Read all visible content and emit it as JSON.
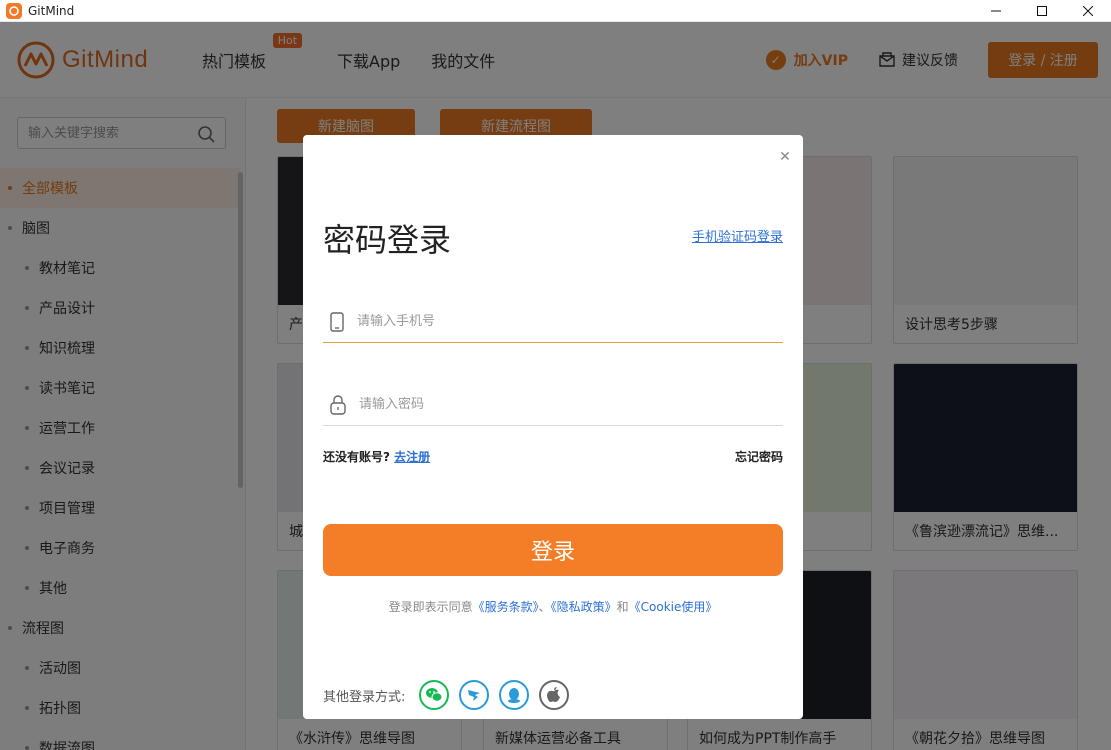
{
  "window": {
    "title": "GitMind"
  },
  "header": {
    "brand": "GitMind",
    "nav": [
      {
        "label": "热门模板",
        "badge": "Hot"
      },
      {
        "label": "下载App"
      },
      {
        "label": "我的文件"
      }
    ],
    "vip_label": "加入VIP",
    "feedback_label": "建议反馈",
    "login_label": "登录 / 注册"
  },
  "sidebar": {
    "search_placeholder": "输入关键字搜索",
    "items": [
      {
        "label": "全部模板",
        "level": "top",
        "active": true
      },
      {
        "label": "脑图",
        "level": "top"
      },
      {
        "label": "教材笔记",
        "level": "sub"
      },
      {
        "label": "产品设计",
        "level": "sub"
      },
      {
        "label": "知识梳理",
        "level": "sub"
      },
      {
        "label": "读书笔记",
        "level": "sub"
      },
      {
        "label": "运营工作",
        "level": "sub"
      },
      {
        "label": "会议记录",
        "level": "sub"
      },
      {
        "label": "项目管理",
        "level": "sub"
      },
      {
        "label": "电子商务",
        "level": "sub"
      },
      {
        "label": "其他",
        "level": "sub"
      },
      {
        "label": "流程图",
        "level": "top"
      },
      {
        "label": "活动图",
        "level": "sub"
      },
      {
        "label": "拓扑图",
        "level": "sub"
      },
      {
        "label": "数据流图",
        "level": "sub"
      }
    ]
  },
  "main": {
    "new_mindmap": "新建脑图",
    "new_flowchart": "新建流程图",
    "cards": [
      {
        "label": "产",
        "thumb": "#2a2a2e"
      },
      {
        "label": "",
        "thumb": "#f6e9e9"
      },
      {
        "label": "设计思考5步骤",
        "thumb": "#f3f3f3"
      },
      {
        "label": "城",
        "thumb": "#e6e6ec"
      },
      {
        "label": "",
        "thumb": "#e7f0d8"
      },
      {
        "label": "《鲁滨逊漂流记》思维...",
        "thumb": "#1d2032"
      },
      {
        "label": "《水浒传》思维导图",
        "thumb": "#e3f1ea"
      },
      {
        "label": "新媒体运营必备工具",
        "thumb": "#ffffff"
      },
      {
        "label": "如何成为PPT制作高手",
        "thumb": "#1f2126"
      },
      {
        "label": "《朝花夕拾》思维导图",
        "thumb": "#f6f0f6"
      }
    ]
  },
  "modal": {
    "title": "密码登录",
    "sms_link": "手机验证码登录",
    "phone_placeholder": "请输入手机号",
    "password_placeholder": "请输入密码",
    "no_account": "还没有账号?",
    "register_link": "去注册",
    "forgot": "忘记密码",
    "submit": "登录",
    "agreement_prefix": "登录即表示同意",
    "terms": "《服务条款》",
    "sep": "、",
    "privacy": "《隐私政策》",
    "and": "和",
    "cookie": "《Cookie使用》",
    "other_label": "其他登录方式:",
    "social": [
      {
        "name": "wechat",
        "color": "#19b955"
      },
      {
        "name": "dingtalk",
        "color": "#2a9bd8"
      },
      {
        "name": "qq",
        "color": "#2a9bd8"
      },
      {
        "name": "apple",
        "color": "#666666"
      }
    ]
  }
}
